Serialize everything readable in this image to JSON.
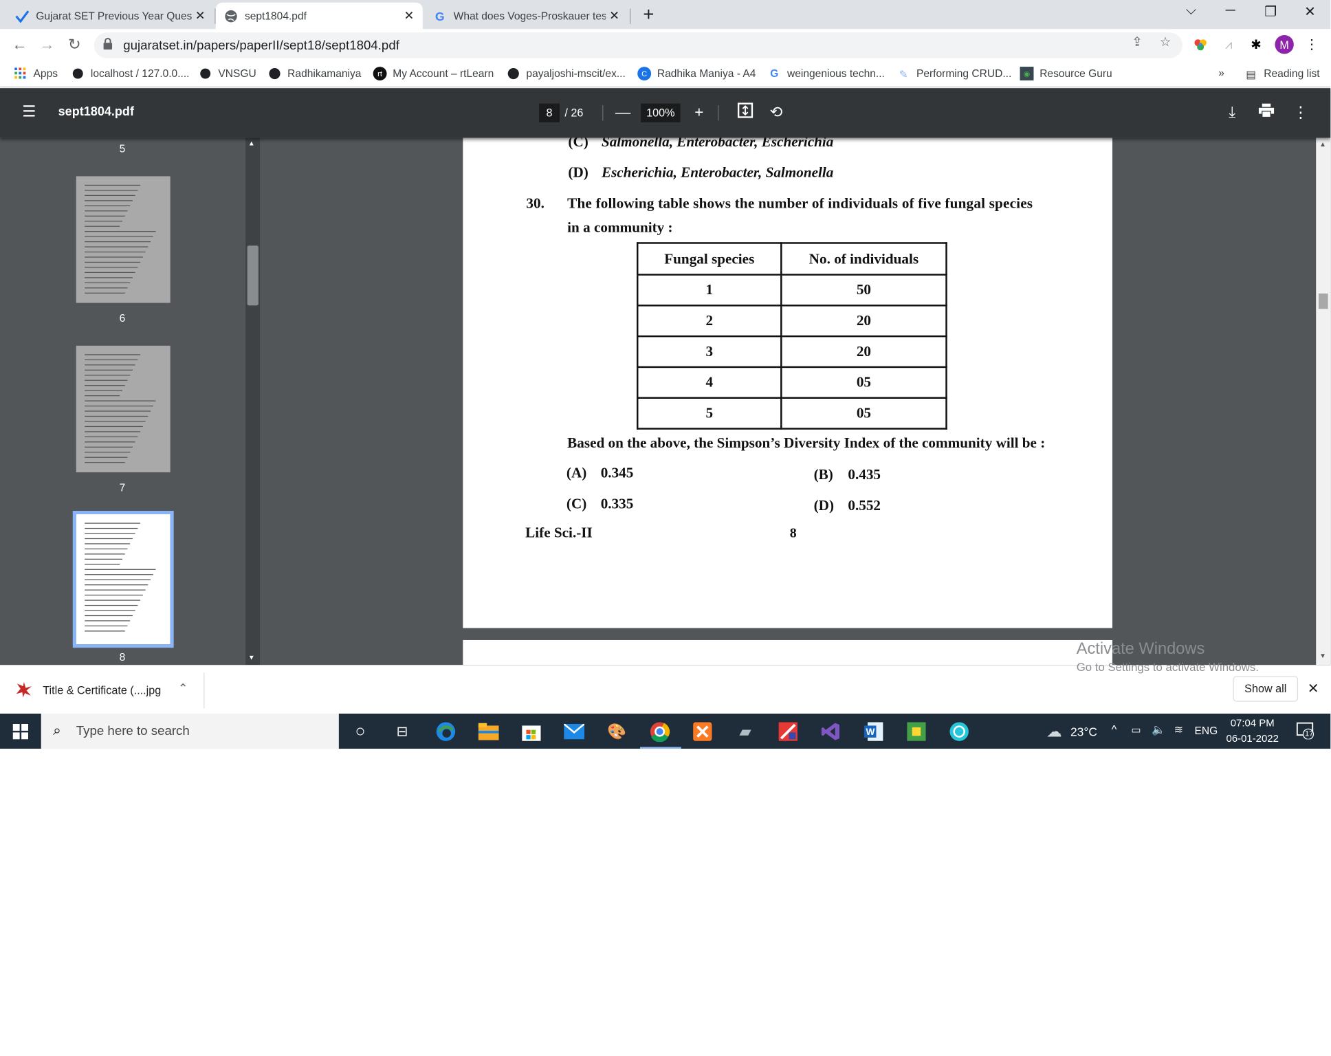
{
  "browser": {
    "tabs": [
      {
        "title": "Gujarat SET Previous Year Questi",
        "favicon": "check-icon"
      },
      {
        "title": "sept1804.pdf",
        "favicon": "globe-icon"
      },
      {
        "title": "What does Voges-Proskauer test",
        "favicon": "google-icon"
      }
    ],
    "url": "gujaratset.in/papers/paperII/sept18/sept1804.pdf",
    "profile_initial": "M",
    "bookmarks": [
      "Apps",
      "localhost / 127.0.0....",
      "VNSGU",
      "Radhikamaniya",
      "My Account – rtLearn",
      "payaljoshi-mscit/ex...",
      "Radhika Maniya - A4",
      "weingenious techn...",
      "Performing CRUD...",
      "Resource Guru"
    ],
    "more_bookmarks": "»",
    "reading_list": "Reading list"
  },
  "pdf": {
    "filename": "sept1804.pdf",
    "current_page": "8",
    "total_pages": "/ 26",
    "zoom": "100%",
    "thumb_pages": [
      "5",
      "6",
      "7",
      "8"
    ],
    "content": {
      "option_c_prev": "(C)",
      "option_c_prev_text": "Salmonella, Enterobacter, Escherichia",
      "option_d_prev": "(D)",
      "option_d_prev_text": "Escherichia, Enterobacter, Salmonella",
      "q_number": "30.",
      "q_line1": "The following table shows the number of individuals of five fungal species",
      "q_line2": "in a community :",
      "table_headers": [
        "Fungal species",
        "No. of individuals"
      ],
      "table_rows": [
        [
          "1",
          "50"
        ],
        [
          "2",
          "20"
        ],
        [
          "3",
          "20"
        ],
        [
          "4",
          "05"
        ],
        [
          "5",
          "05"
        ]
      ],
      "q_followup": "Based on the above, the Simpson’s Diversity Index of the community will be :",
      "options": [
        {
          "label": "(A)",
          "value": "0.345"
        },
        {
          "label": "(B)",
          "value": "0.435"
        },
        {
          "label": "(C)",
          "value": "0.335"
        },
        {
          "label": "(D)",
          "value": "0.552"
        }
      ],
      "footer_left": "Life Sci.-II",
      "footer_page": "8"
    }
  },
  "watermark": {
    "line1": "Activate Windows",
    "line2": "Go to Settings to activate Windows."
  },
  "download_bar": {
    "file": "Title & Certificate (....jpg",
    "show_all": "Show all"
  },
  "taskbar": {
    "search_placeholder": "Type here to search",
    "temperature": "23°C",
    "language": "ENG",
    "time": "07:04 PM",
    "date": "06-01-2022",
    "notifications": "17"
  },
  "colors": {
    "pdf_toolbar": "#323639",
    "pdf_background": "#525659",
    "taskbar": "#1f2d3a",
    "selected_thumb": "#8ab4f8"
  }
}
